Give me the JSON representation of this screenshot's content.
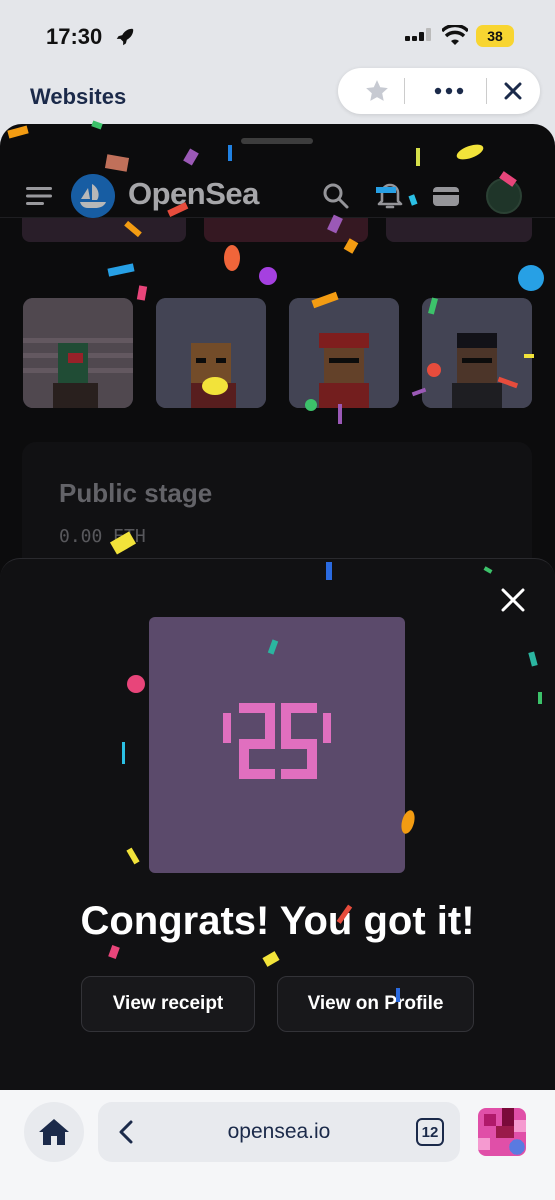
{
  "status_bar": {
    "time": "17:30",
    "battery": "38"
  },
  "header": {
    "title": "Websites"
  },
  "site": {
    "brand": "OpenSea"
  },
  "stage": {
    "title": "Public stage",
    "price": "0.00 ETH"
  },
  "modal": {
    "art_text": "'25'",
    "message": "Congrats! You got it!",
    "receipt_label": "View receipt",
    "profile_label": "View on Profile"
  },
  "bottom_bar": {
    "url": "opensea.io",
    "tab_count": "12"
  },
  "colors": {
    "accent": "#2081e2",
    "sheet_bg": "#111113",
    "art_bg": "#5b4a6b",
    "art_fg": "#e06fbf",
    "battery": "#f8d531"
  },
  "icons": [
    "rocket-icon",
    "signal-icon",
    "wifi-icon",
    "star-icon",
    "more-icon",
    "close-icon",
    "menu-icon",
    "opensea-logo",
    "search-icon",
    "bell-icon",
    "wallet-icon",
    "avatar",
    "home-icon",
    "back-icon",
    "tabs-icon"
  ]
}
